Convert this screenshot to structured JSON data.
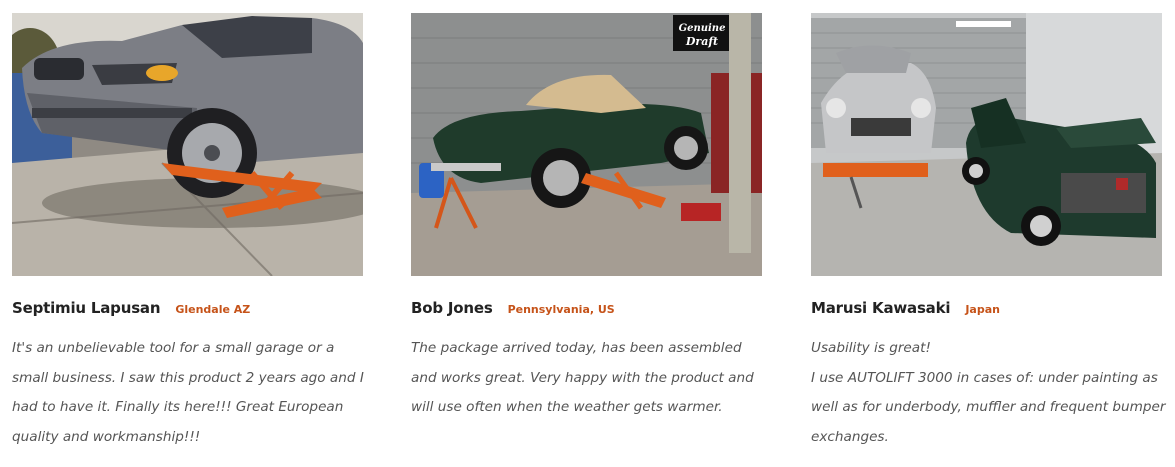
{
  "testimonials": [
    {
      "photo_alt": "",
      "name": "Septimiu Lapusan",
      "location": "Glendale AZ",
      "quote_lines": [
        "It's an unbelievable tool for a small garage or a",
        "small business. I saw this product 2 years ago and I",
        "had to have it. Finally its here!!! Great European",
        "quality and workmanship!!!"
      ]
    },
    {
      "photo_alt": "",
      "name": "Bob Jones",
      "location": "Pennsylvania, US",
      "quote_lines": [
        "The package arrived today, has been assembled",
        "and works great. Very happy with the product and",
        "will use often when the weather gets warmer."
      ]
    },
    {
      "photo_alt": "",
      "name": "Marusi Kawasaki",
      "location": "Japan",
      "quote_lines": [
        "Usability is great!",
        "I use AUTOLIFT 3000 in cases of: under painting as",
        "well as for underbody, muffler and frequent bumper",
        "exchanges."
      ]
    }
  ],
  "photo_2_sign": {
    "line1": "Genuine",
    "line2": "Draft"
  },
  "colors": {
    "location_accent": "#c65319",
    "name_text": "#222222",
    "quote_text": "#555555",
    "lift_orange": "#e0601c"
  }
}
